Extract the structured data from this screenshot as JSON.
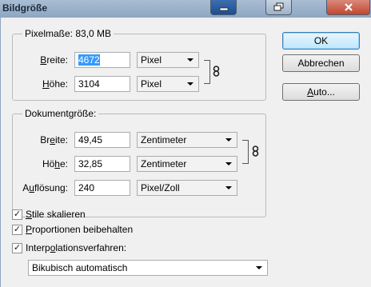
{
  "window": {
    "title": "Bildgröße"
  },
  "pixel_dimensions": {
    "legend": "Pixelmaße: 83,0 MB",
    "width_label": "Breite:",
    "width_value": "4672",
    "width_unit": "Pixel",
    "height_label": "Höhe:",
    "height_value": "3104",
    "height_unit": "Pixel"
  },
  "document_size": {
    "legend": "Dokumentgröße:",
    "width_label": "Breite:",
    "width_value": "49,45",
    "width_unit": "Zentimeter",
    "height_label": "Höhe:",
    "height_value": "32,85",
    "height_unit": "Zentimeter",
    "resolution_label": "Auflösung:",
    "resolution_value": "240",
    "resolution_unit": "Pixel/Zoll"
  },
  "buttons": {
    "ok": "OK",
    "cancel": "Abbrechen",
    "auto": "Auto..."
  },
  "options": {
    "scale_styles": {
      "label": "Stile skalieren",
      "checked": true
    },
    "constrain_proportions": {
      "label": "Proportionen beibehalten",
      "checked": true
    },
    "resample": {
      "label": "Interpolationsverfahren:",
      "checked": true
    },
    "resample_method": "Bikubisch automatisch"
  },
  "icons": {
    "link": "chain-link-icon",
    "checkmark": "✓"
  }
}
